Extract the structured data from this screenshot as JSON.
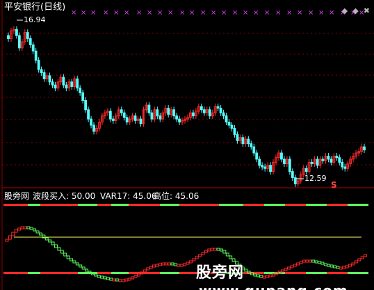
{
  "top_panel": {
    "title": "平安银行(日线)",
    "high_label": "16.94",
    "low_label": "12.59",
    "sell_marker": "S",
    "cross_marker": "×",
    "title_color": "#ffffff",
    "up_color": "#ff2a2a",
    "down_color": "#54ffff"
  },
  "bottom_panel": {
    "indicator_name": "股旁网",
    "buy_label": "波段买入: 50.00",
    "var_label": "VAR17: 45.06",
    "high_label": "高位: 45.06",
    "indicator_color": "#ffffff",
    "buy_color": "#ffffff",
    "var_color": "#ffffff",
    "high_color": "#ffffff",
    "up_color": "#ff2a2a",
    "down_color": "#5dff5d",
    "ref_line_color": "#ffff66"
  },
  "hud": {
    "icons": [
      "diamond-icon",
      "diamond-icon",
      "close-icon"
    ]
  },
  "watermark": {
    "text": "股旁网",
    "url": "www.gupang.com"
  },
  "chart_data": [
    {
      "type": "candlestick",
      "title": "平安银行(日线)",
      "annotations": [
        "16.94",
        "12.59"
      ],
      "ylim": [
        12.0,
        17.4
      ],
      "close": [
        16.6,
        16.85,
        16.9,
        16.7,
        16.3,
        16.5,
        16.8,
        16.6,
        16.4,
        16.2,
        15.9,
        15.6,
        15.5,
        15.3,
        15.4,
        15.2,
        15.1,
        15.0,
        15.2,
        15.35,
        15.1,
        15.0,
        15.2,
        15.05,
        15.3,
        15.0,
        14.85,
        14.6,
        14.3,
        14.0,
        13.8,
        13.6,
        13.7,
        13.9,
        14.1,
        14.2,
        14.25,
        14.0,
        13.95,
        14.1,
        14.3,
        14.2,
        14.05,
        13.9,
        14.0,
        14.1,
        13.95,
        14.0,
        13.85,
        14.3,
        14.45,
        14.2,
        14.0,
        14.3,
        14.1,
        14.0,
        14.2,
        14.35,
        14.15,
        14.3,
        14.1,
        14.0,
        13.9,
        13.95,
        14.0,
        14.05,
        14.2,
        14.1,
        14.25,
        14.4,
        14.3,
        14.2,
        14.3,
        14.1,
        14.2,
        14.4,
        14.35,
        14.2,
        14.1,
        13.9,
        13.8,
        13.7,
        13.5,
        13.3,
        13.4,
        13.2,
        13.35,
        13.2,
        13.1,
        12.9,
        12.7,
        12.5,
        12.45,
        12.4,
        12.5,
        12.3,
        12.6,
        12.75,
        12.9,
        12.7,
        12.55,
        12.7,
        12.3,
        12.1,
        11.9,
        12.0,
        12.2,
        12.4,
        12.3,
        12.6,
        12.55,
        12.7,
        12.5,
        12.7,
        12.65,
        12.8,
        12.7,
        12.6,
        12.8,
        12.75,
        12.6,
        12.45,
        12.4,
        12.55,
        12.7,
        12.8,
        12.9,
        12.95,
        13.1,
        13.0
      ],
      "high_point": 16.94,
      "low_point": 12.59
    },
    {
      "type": "line",
      "title": "股旁网",
      "series": [
        {
          "name": "波段买入",
          "value": 50.0
        },
        {
          "name": "VAR17",
          "value": 45.06
        },
        {
          "name": "高位",
          "value": 45.06
        }
      ],
      "ylim": [
        0,
        100
      ],
      "values": [
        60,
        65,
        70,
        74,
        76,
        78,
        78,
        77,
        75,
        72,
        69,
        66,
        62,
        59,
        56,
        52,
        48,
        44,
        40,
        36,
        32,
        29,
        26,
        23,
        20,
        17,
        14,
        12,
        10,
        8,
        7,
        6,
        5,
        4,
        3,
        3,
        2,
        2,
        2,
        3,
        4,
        6,
        8,
        10,
        13,
        16,
        19,
        21,
        23,
        24,
        25,
        26,
        26,
        26,
        25,
        24,
        24,
        24,
        25,
        27,
        29,
        32,
        35,
        38,
        41,
        44,
        46,
        47,
        47,
        46,
        44,
        40,
        36,
        32,
        28,
        24,
        20,
        17,
        14,
        12,
        10,
        9,
        8,
        7,
        7,
        8,
        9,
        10,
        12,
        14,
        16,
        18,
        20,
        22,
        24,
        26,
        28,
        30,
        30,
        30,
        29,
        28,
        27,
        25,
        24,
        23,
        22,
        21,
        20,
        20,
        21,
        22,
        24,
        26,
        29,
        32,
        35,
        38
      ]
    }
  ]
}
